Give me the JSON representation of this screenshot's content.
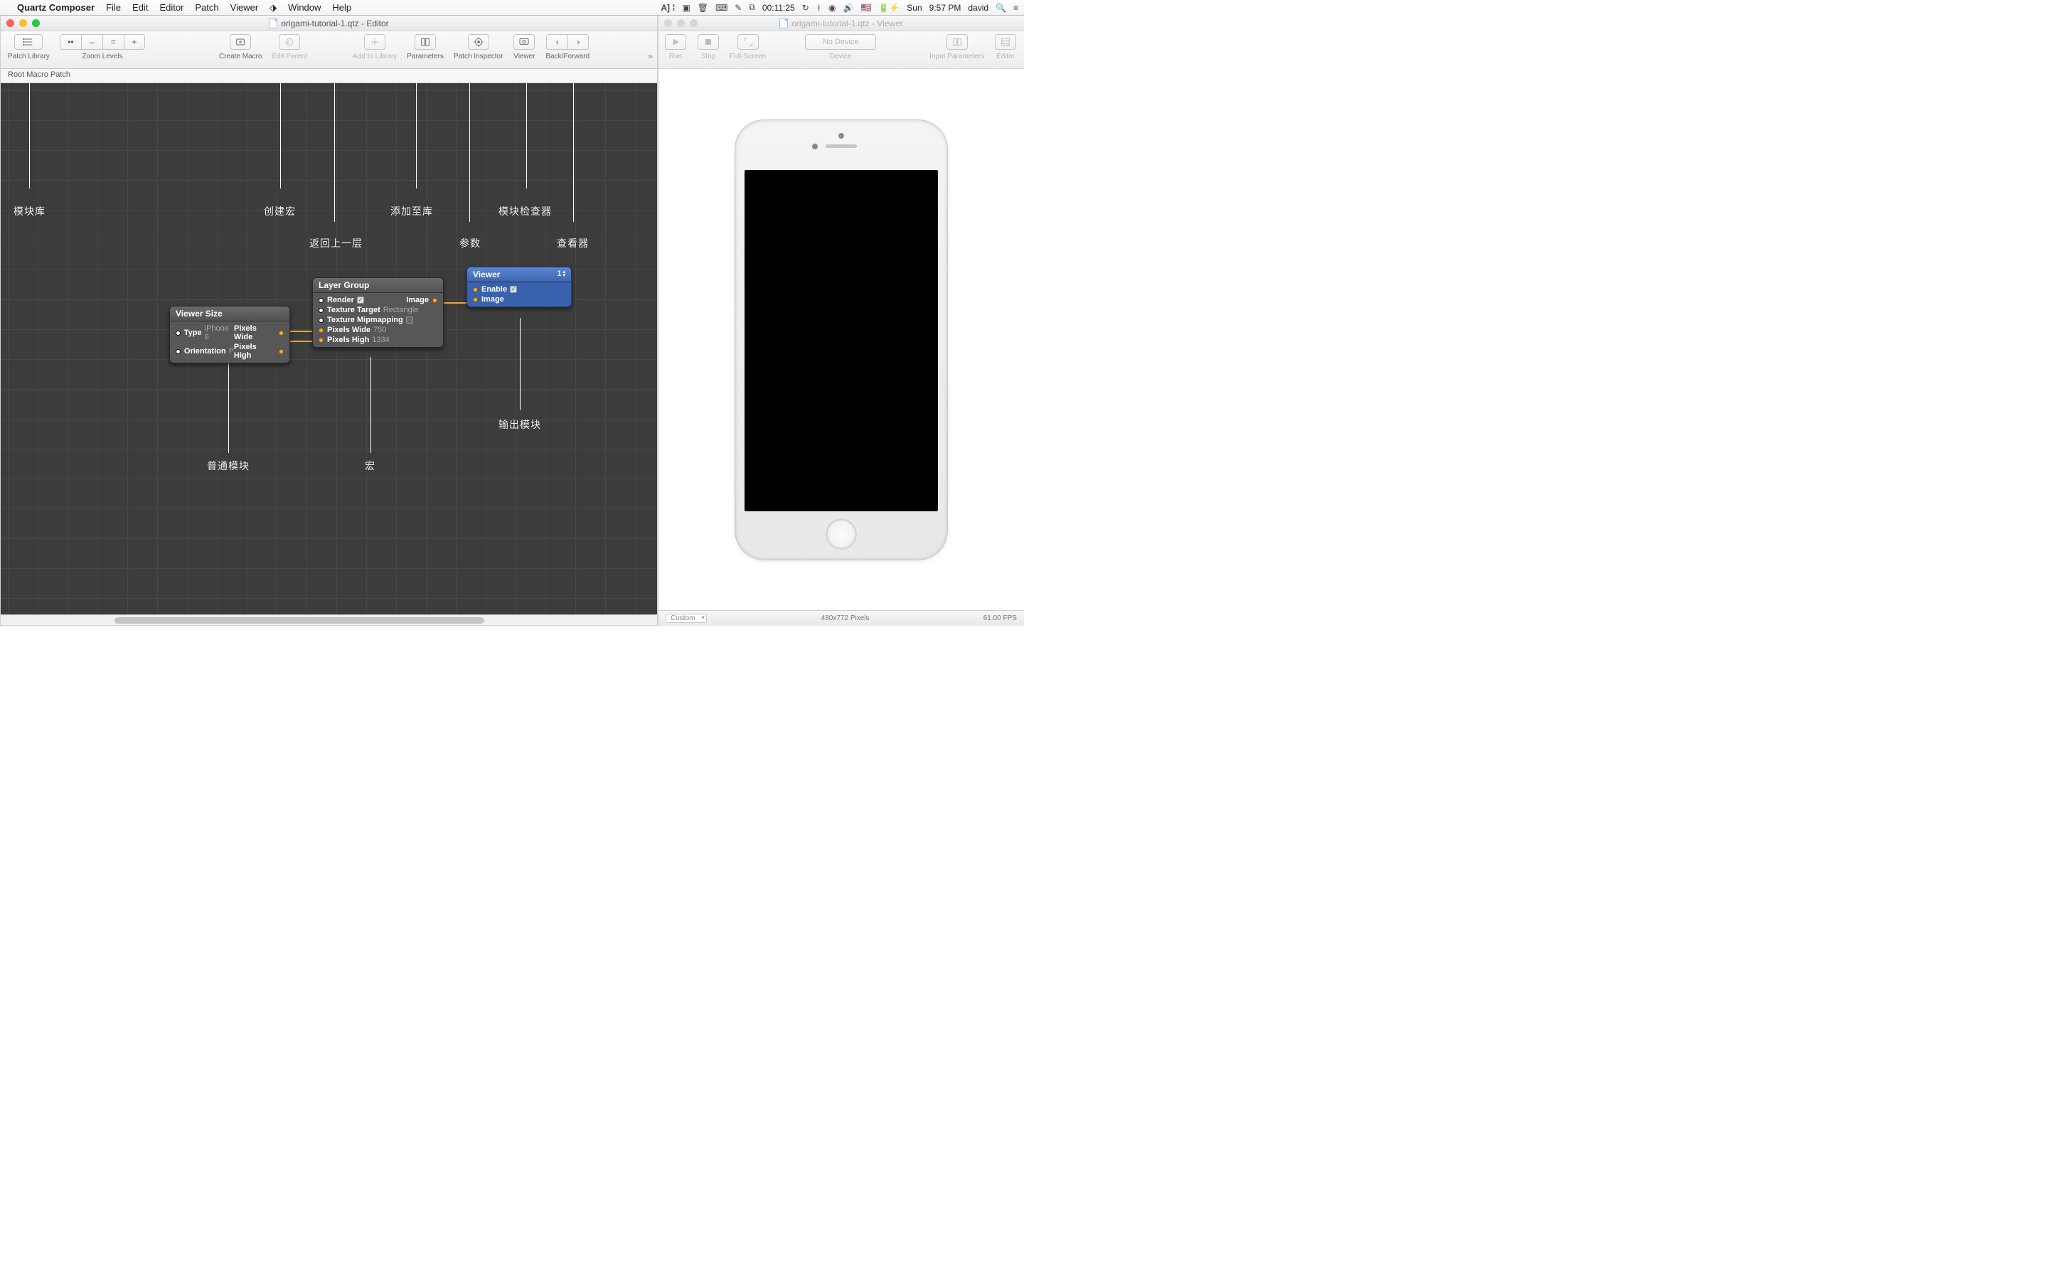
{
  "menu": {
    "app": "Quartz Composer",
    "items": [
      "File",
      "Edit",
      "Editor",
      "Patch",
      "Viewer",
      "Window",
      "Help"
    ],
    "right": {
      "timer": "00:11:25",
      "day": "Sun",
      "time": "9:57 PM",
      "user": "david"
    }
  },
  "editor": {
    "title": "origami-tutorial-1.qtz - Editor",
    "breadcrumb": "Root Macro Patch",
    "toolbar": {
      "patch_library": "Patch Library",
      "zoom": "Zoom Levels",
      "zoom_btns": [
        "••",
        "–",
        "=",
        "+"
      ],
      "create_macro": "Create Macro",
      "edit_parent": "Edit Parent",
      "add_to_library": "Add to Library",
      "parameters": "Parameters",
      "patch_inspector": "Patch Inspector",
      "viewer": "Viewer",
      "back_forward": "Back/Forward"
    },
    "callouts": {
      "lib": "模块库",
      "macro": "创建宏",
      "addlib": "添加至库",
      "inspector": "模块检查器",
      "back": "返回上一层",
      "params": "参数",
      "viewer": "查看器",
      "normal": "普通模块",
      "hong": "宏",
      "output": "输出模块"
    },
    "node_viewer_size": {
      "title": "Viewer Size",
      "type_lab": "Type",
      "type_val": "iPhone 6",
      "orient_lab": "Orientation",
      "orient_val": "P",
      "pw": "Pixels Wide",
      "ph": "Pixels High"
    },
    "node_layer": {
      "title": "Layer Group",
      "render": "Render",
      "tt": "Texture Target",
      "tt_val": "Rectangle",
      "tm": "Texture Mipmapping",
      "pw": "Pixels Wide",
      "pw_val": "750",
      "ph": "Pixels High",
      "ph_val": "1334",
      "image": "Image"
    },
    "node_view": {
      "title": "Viewer",
      "index": "1",
      "enable": "Enable",
      "image": "Image"
    }
  },
  "viewer": {
    "title": "origami-tutorial-1.qtz - Viewer",
    "toolbar": {
      "run": "Run",
      "stop": "Stop",
      "fullscreen": "Full-Screen",
      "device": "Device",
      "no_device": "No Device",
      "input_params": "Input Parameters",
      "editor": "Editor"
    },
    "footer": {
      "size_mode": "Custom",
      "dims": "480x772 Pixels",
      "fps": "61.00 FPS"
    }
  }
}
